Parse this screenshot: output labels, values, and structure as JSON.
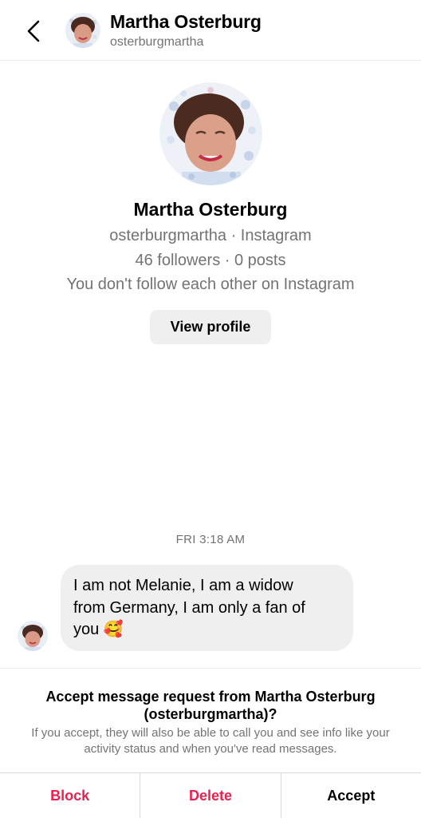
{
  "header": {
    "name": "Martha Osterburg",
    "username": "osterburgmartha"
  },
  "profile": {
    "name": "Martha Osterburg",
    "source_line": "osterburgmartha · Instagram",
    "stats_line": "46 followers · 0 posts",
    "relation_line": "You don't follow each other on Instagram",
    "view_profile_label": "View profile"
  },
  "thread": {
    "timestamp": "FRI 3:18 AM",
    "messages": [
      {
        "line1": "I am not Melanie,  I am a widow",
        "line2": "from Germany,  I  am only a fan of",
        "line3": "you",
        "emoji": "🥰"
      }
    ]
  },
  "request": {
    "title": "Accept message request from Martha Osterburg (osterburgmartha)?",
    "description": "If you accept, they will also be able to call you and see info like your activity status and when you've read messages."
  },
  "actions": {
    "block_label": "Block",
    "delete_label": "Delete",
    "accept_label": "Accept"
  },
  "colors": {
    "destructive": "#ed1f4f",
    "secondary_text": "#737373",
    "bubble_bg": "#efefef"
  },
  "icons": {
    "back": "chevron-left-icon",
    "avatar": "profile-photo"
  }
}
